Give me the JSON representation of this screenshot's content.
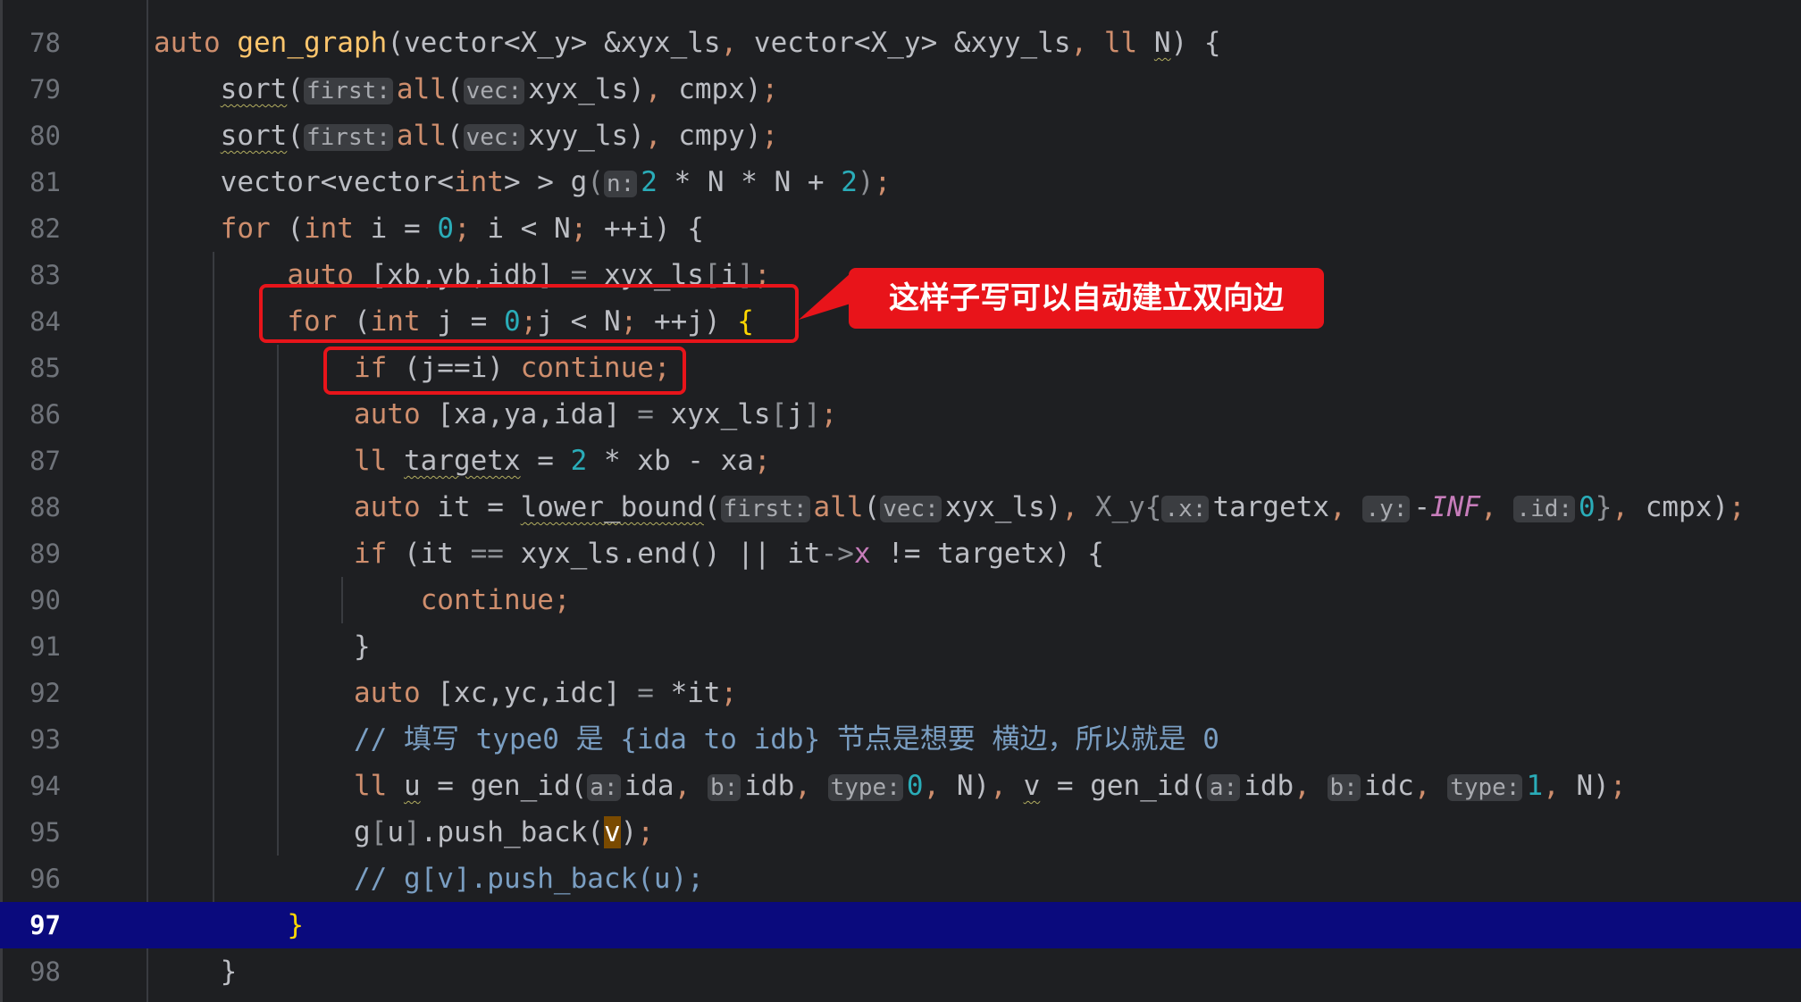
{
  "line_numbers": [
    "78",
    "79",
    "80",
    "81",
    "82",
    "83",
    "84",
    "85",
    "86",
    "87",
    "88",
    "89",
    "90",
    "91",
    "92",
    "93",
    "94",
    "95",
    "96",
    "97",
    "98"
  ],
  "current_line": "97",
  "hints": {
    "first": "first:",
    "vec": "vec:",
    "n": "n:",
    "x": ".x:",
    "y": ".y:",
    "id": ".id:",
    "a": "a:",
    "b": "b:",
    "type": "type:"
  },
  "comments": {
    "line93": "// 填写 type0 是 {ida to idb} 节点是想要 横边，所以就是 0",
    "line96": "// g[v].push_back(u);"
  },
  "annotation": {
    "text": "这样子写可以自动建立双向边",
    "color": "#e8141a"
  }
}
